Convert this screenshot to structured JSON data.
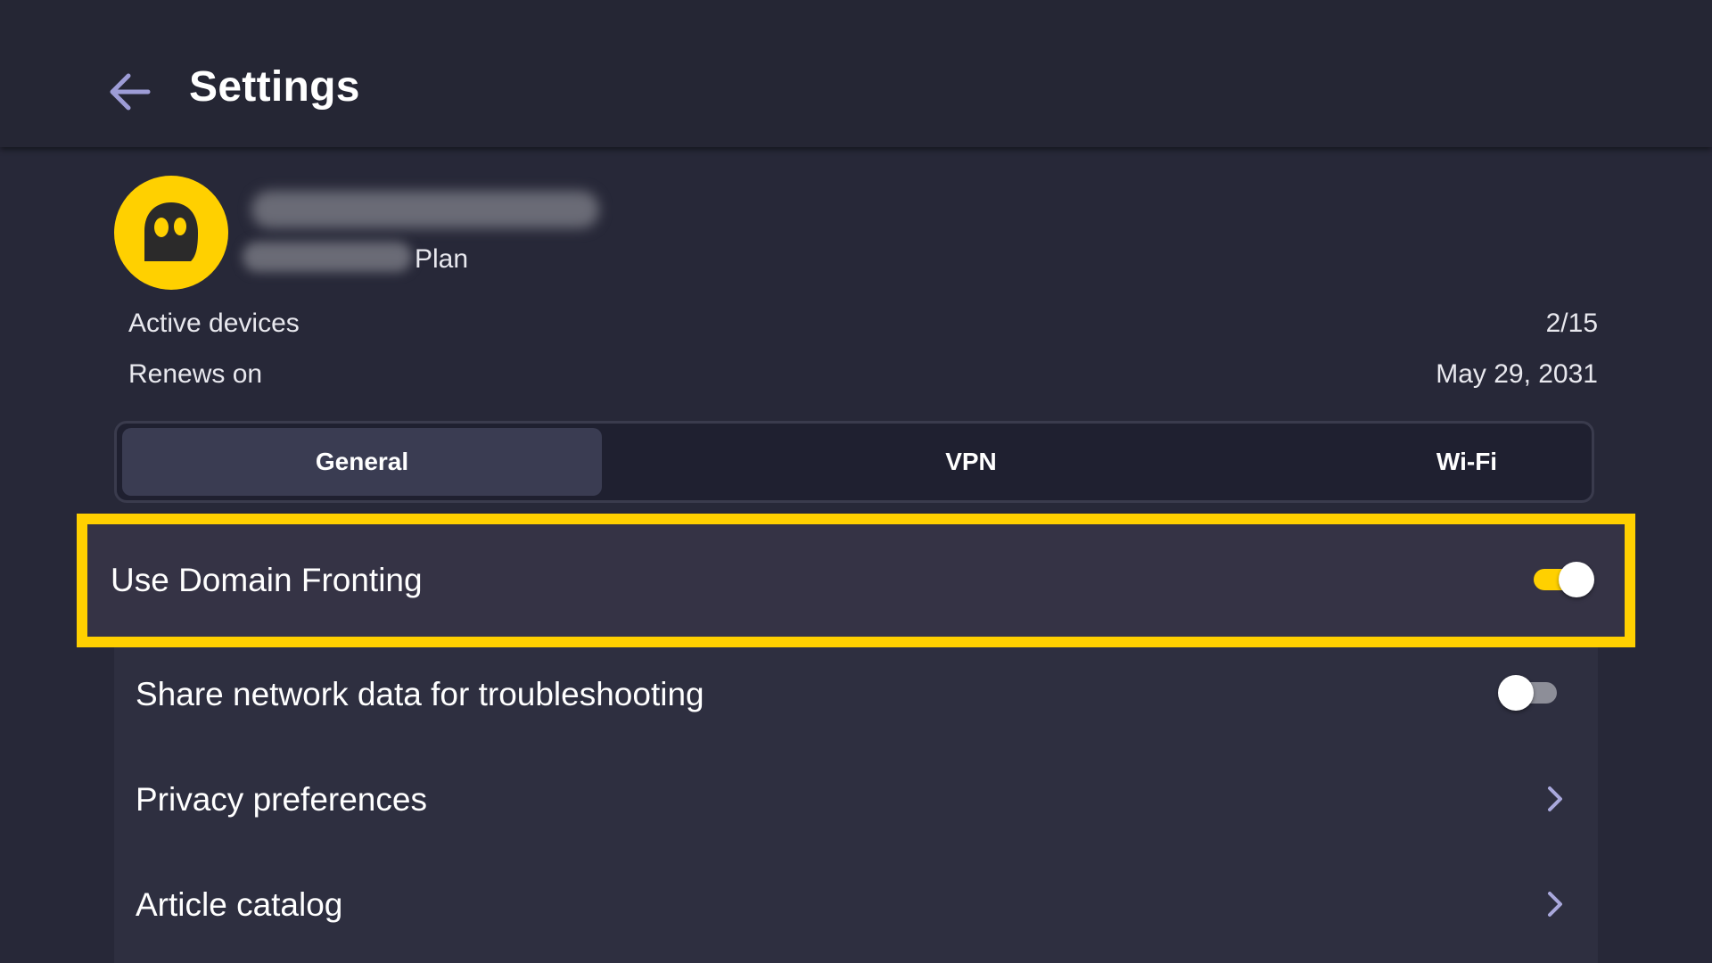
{
  "header": {
    "title": "Settings",
    "back_icon": "arrow-left-icon"
  },
  "account": {
    "plan_label": "Plan",
    "avatar_icon": "ghost-logo-icon",
    "active_devices_label": "Active devices",
    "active_devices_value": "2/15",
    "renews_label": "Renews on",
    "renews_value": "May 29, 2031"
  },
  "tabs": [
    {
      "label": "General",
      "active": true
    },
    {
      "label": "VPN",
      "active": false
    },
    {
      "label": "Wi-Fi",
      "active": false
    }
  ],
  "settings": {
    "domain_fronting": {
      "label": "Use Domain Fronting",
      "enabled": true
    },
    "share_network_data": {
      "label": "Share network data for troubleshooting",
      "enabled": false
    },
    "privacy_preferences": {
      "label": "Privacy preferences",
      "icon": "chevron-right-icon"
    },
    "article_catalog": {
      "label": "Article catalog",
      "icon": "chevron-right-icon"
    }
  },
  "colors": {
    "accent": "#ffd000",
    "background": "#272838",
    "header": "#252634",
    "list_background": "#2e2f40"
  }
}
